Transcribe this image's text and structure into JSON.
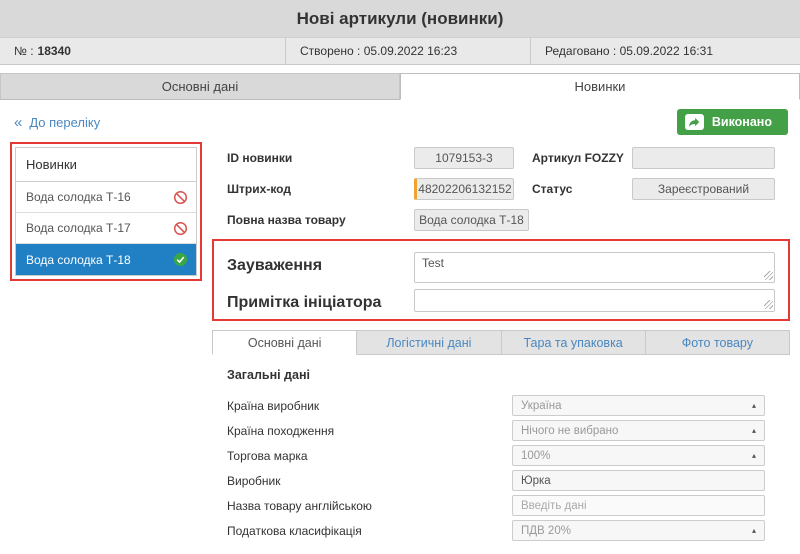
{
  "colors": {
    "accent_green": "#43a047",
    "selected_blue": "#2180c4",
    "orange_marker": "#f0a32e",
    "annotation_red": "#e53935",
    "link_blue": "#4a87c0"
  },
  "icons": {
    "back_chevron": "«",
    "dropdown_caret": "▴"
  },
  "header": {
    "title": "Нові артикули (новинки)",
    "number_prefix": "№ :",
    "number": "18340",
    "created": "Створено : 05.09.2022 16:23",
    "edited": "Редаговано : 05.09.2022 16:31"
  },
  "tabs": [
    {
      "label": "Основні дані",
      "active": false
    },
    {
      "label": "Новинки",
      "active": true
    }
  ],
  "toolbar": {
    "back_link": "До переліку",
    "done_button": "Виконано"
  },
  "sidebar": {
    "title": "Новинки",
    "items": [
      {
        "label": "Вода солодка Т-16",
        "status": "blocked",
        "selected": false
      },
      {
        "label": "Вода солодка Т-17",
        "status": "blocked",
        "selected": false
      },
      {
        "label": "Вода солодка Т-18",
        "status": "done",
        "selected": true
      }
    ]
  },
  "form": {
    "id_label": "ID новинки",
    "id_value": "1079153-3",
    "artikul_label": "Артикул FOZZY",
    "artikul_value": "",
    "barcode_label": "Штрих-код",
    "barcode_value": "48202206132152",
    "status_label": "Статус",
    "status_value": "Зареєстрований",
    "fullname_label": "Повна назва товару",
    "fullname_value": "Вода солодка Т-18",
    "note_label": "Зауваження",
    "note_value": "Test",
    "initiator_note_label": "Примітка ініціатора",
    "initiator_note_value": ""
  },
  "subtabs": [
    {
      "label": "Основні дані",
      "active": true
    },
    {
      "label": "Логістичні дані",
      "active": false
    },
    {
      "label": "Тара та упаковка",
      "active": false
    },
    {
      "label": "Фото товару",
      "active": false
    }
  ],
  "section": {
    "title": "Загальні дані",
    "fields": [
      {
        "label": "Країна виробник",
        "value": "Україна",
        "type": "select",
        "orange": true
      },
      {
        "label": "Країна походження",
        "value": "Нічого не вибрано",
        "type": "select",
        "orange": false
      },
      {
        "label": "Торгова марка",
        "value": "100%",
        "type": "select",
        "orange": true
      },
      {
        "label": "Виробник",
        "value": "Юрка",
        "type": "input",
        "orange": true
      },
      {
        "label": "Назва товару англійською",
        "value": "",
        "placeholder": "Введіть дані",
        "type": "input",
        "orange": false
      },
      {
        "label": "Податкова класифікація",
        "value": "ПДВ 20%",
        "type": "select",
        "orange": true
      }
    ]
  }
}
